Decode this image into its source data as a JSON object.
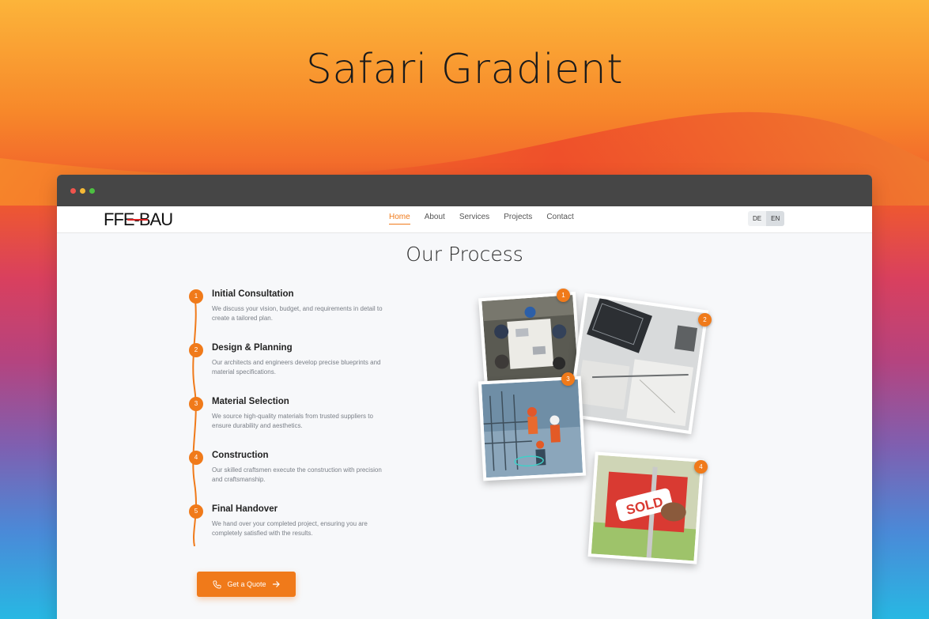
{
  "hero": {
    "title": "Safari Gradient"
  },
  "site": {
    "logo_text": "FFE-BAU",
    "nav": [
      {
        "label": "Home",
        "active": true
      },
      {
        "label": "About"
      },
      {
        "label": "Services"
      },
      {
        "label": "Projects"
      },
      {
        "label": "Contact"
      }
    ],
    "languages": [
      {
        "label": "DE"
      },
      {
        "label": "EN",
        "selected": true
      }
    ]
  },
  "process": {
    "title": "Our Process",
    "steps": [
      {
        "number": "1",
        "title": "Initial Consultation",
        "description": "We discuss your vision, budget, and requirements in detail to create a tailored plan."
      },
      {
        "number": "2",
        "title": "Design & Planning",
        "description": "Our architects and engineers develop precise blueprints and material specifications."
      },
      {
        "number": "3",
        "title": "Material Selection",
        "description": "We source high-quality materials from trusted suppliers to ensure durability and aesthetics."
      },
      {
        "number": "4",
        "title": "Construction",
        "description": "Our skilled craftsmen execute the construction with precision and craftsmanship."
      },
      {
        "number": "5",
        "title": "Final Handover",
        "description": "We hand over your completed project, ensuring you are completely satisfied with the results."
      }
    ],
    "cta_label": "Get a Quote",
    "photo_badges": [
      "1",
      "2",
      "3",
      "4"
    ],
    "sign_text": "SOLD"
  },
  "colors": {
    "accent": "#f07a1a",
    "titlebar": "#464646"
  },
  "icons": {
    "cta_left": "phone-icon",
    "cta_right": "arrow-right-icon"
  }
}
